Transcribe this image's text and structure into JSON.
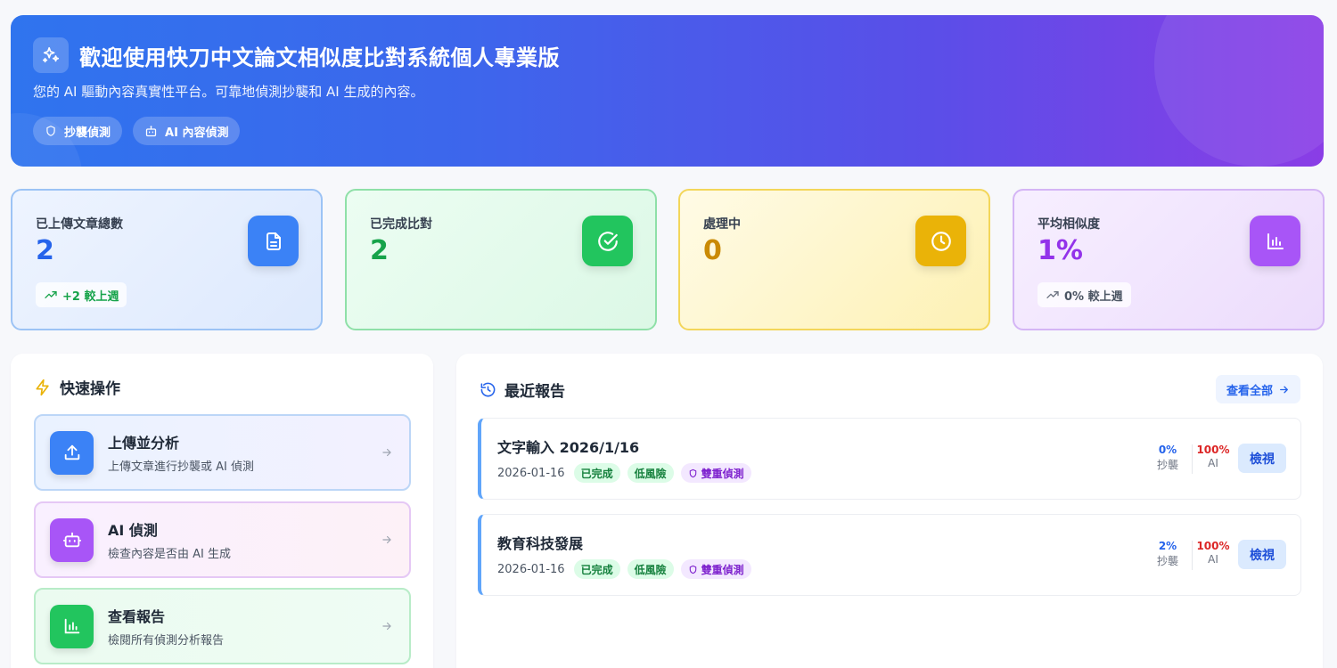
{
  "banner": {
    "title": "歡迎使用快刀中文論文相似度比對系統個人專業版",
    "subtitle": "您的 AI 驅動內容真實性平台。可靠地偵測抄襲和 AI 生成的內容。",
    "tags": [
      {
        "icon": "shield-icon",
        "label": "抄襲偵測"
      },
      {
        "icon": "bot-icon",
        "label": "AI 內容偵測"
      }
    ]
  },
  "stats": [
    {
      "label": "已上傳文章總數",
      "value": "2",
      "trend": "+2 較上週",
      "icon": "document-icon",
      "color": "#3b82f6"
    },
    {
      "label": "已完成比對",
      "value": "2",
      "trend": "",
      "icon": "check-circle-icon",
      "color": "#22c55e"
    },
    {
      "label": "處理中",
      "value": "0",
      "trend": "",
      "icon": "clock-icon",
      "color": "#eab308"
    },
    {
      "label": "平均相似度",
      "value": "1%",
      "trend": "0% 較上週",
      "icon": "bar-chart-icon",
      "color": "#a855f7"
    }
  ],
  "quick_actions": {
    "title": "快速操作",
    "items": [
      {
        "title": "上傳並分析",
        "desc": "上傳文章進行抄襲或 AI 偵測",
        "icon": "upload-icon"
      },
      {
        "title": "AI 偵測",
        "desc": "檢查內容是否由 AI 生成",
        "icon": "bot-icon"
      },
      {
        "title": "查看報告",
        "desc": "檢閱所有偵測分析報告",
        "icon": "bar-chart-icon"
      }
    ]
  },
  "recent_reports": {
    "title": "最近報告",
    "view_all": "查看全部",
    "status_label": "已完成",
    "risk_label": "低風險",
    "mode_label": "雙重偵測",
    "plag_label": "抄襲",
    "ai_label": "AI",
    "view_label": "檢視",
    "items": [
      {
        "title": "文字輸入 2026/1/16",
        "date": "2026-01-16",
        "plagiarism": "0%",
        "ai": "100%"
      },
      {
        "title": "教育科技發展",
        "date": "2026-01-16",
        "plagiarism": "2%",
        "ai": "100%"
      }
    ]
  },
  "colors": {
    "accent_blue": "#2563eb",
    "success_green": "#16a34a",
    "warning_yellow": "#ca8a04",
    "purple": "#9333ea",
    "danger_red": "#dc2626"
  }
}
